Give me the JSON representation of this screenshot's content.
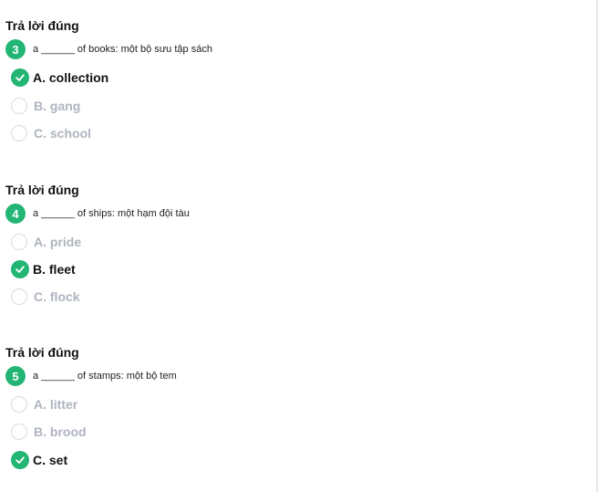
{
  "colors": {
    "accent": "#22b573",
    "muted_text": "#aeb4bf",
    "radio_border": "#dcdcdc"
  },
  "questions": [
    {
      "status": "Trả lời đúng",
      "number": "3",
      "prompt": "a ______ of books: một bộ sưu tập sách",
      "options": [
        {
          "label": "A. collection",
          "correct": true
        },
        {
          "label": "B. gang",
          "correct": false
        },
        {
          "label": "C. school",
          "correct": false
        }
      ]
    },
    {
      "status": "Trả lời đúng",
      "number": "4",
      "prompt": "a ______ of ships: một hạm đội tàu",
      "options": [
        {
          "label": "A. pride",
          "correct": false
        },
        {
          "label": "B. fleet",
          "correct": true
        },
        {
          "label": "C. flock",
          "correct": false
        }
      ]
    },
    {
      "status": "Trả lời đúng",
      "number": "5",
      "prompt": "a ______ of stamps: một bộ tem",
      "options": [
        {
          "label": "A. litter",
          "correct": false
        },
        {
          "label": "B. brood",
          "correct": false
        },
        {
          "label": "C. set",
          "correct": true
        }
      ]
    }
  ]
}
